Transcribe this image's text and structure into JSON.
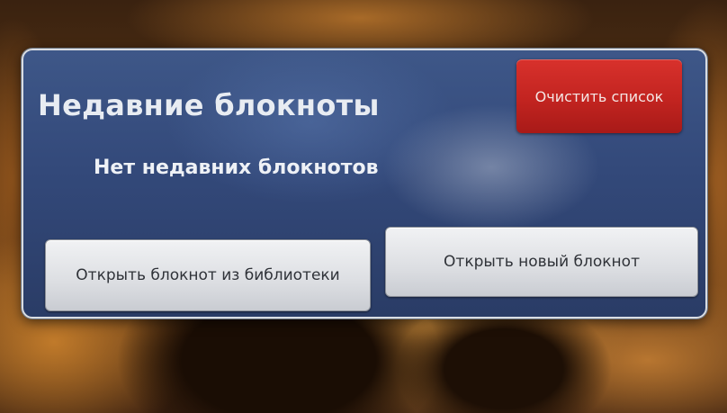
{
  "dialog": {
    "title": "Недавние блокноты",
    "clear_button_label": "Очистить список",
    "empty_message": "Нет недавних блокнотов",
    "open_library_button_label": "Открыть блокнот из библиотеки",
    "open_new_button_label": "Открыть новый блокнот"
  },
  "colors": {
    "dialog_background": "#33497a",
    "clear_button": "#c22420",
    "secondary_button": "#dcdee2"
  }
}
